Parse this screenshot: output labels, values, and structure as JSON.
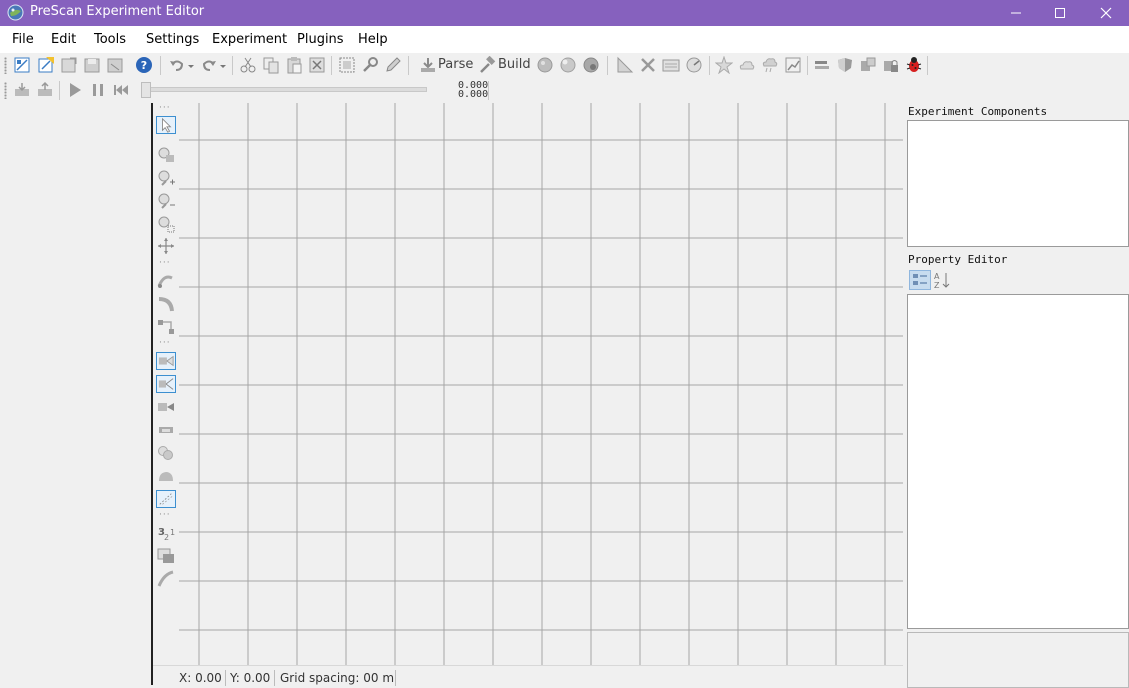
{
  "window": {
    "title": "PreScan Experiment Editor",
    "accent_color": "#8661be"
  },
  "menubar": {
    "items": [
      {
        "label": "File"
      },
      {
        "label": "Edit"
      },
      {
        "label": "Tools"
      },
      {
        "label": "Settings"
      },
      {
        "label": "Experiment"
      },
      {
        "label": "Plugins"
      },
      {
        "label": "Help"
      }
    ]
  },
  "toolbar": {
    "parse_label": "Parse",
    "build_label": "Build"
  },
  "playback": {
    "time_top": "0.000",
    "time_bottom": "0.000",
    "slider_position": 0
  },
  "status": {
    "x": "X: 0.00",
    "y": "Y: 0.00",
    "grid": "Grid spacing: 00 m"
  },
  "right_panel": {
    "components_title": "Experiment Components",
    "property_title": "Property Editor"
  }
}
